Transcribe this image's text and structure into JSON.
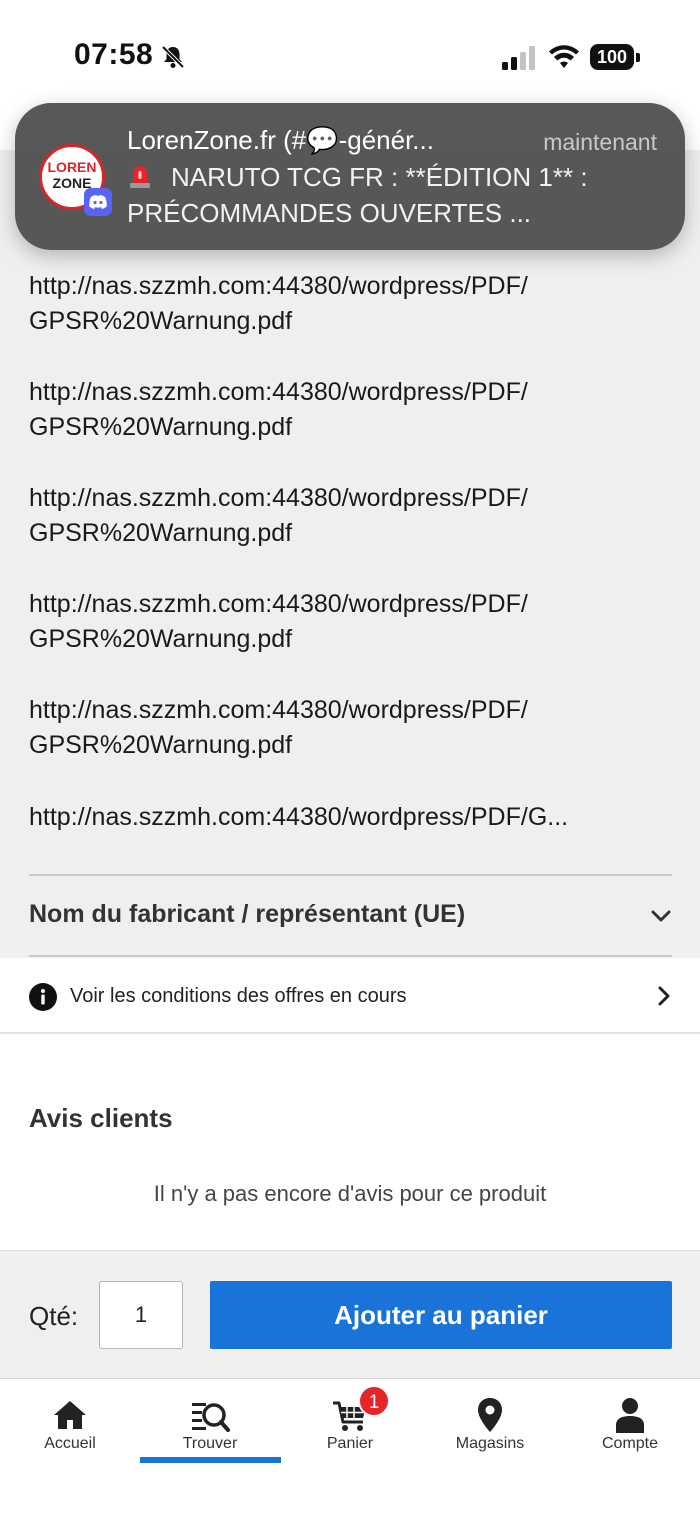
{
  "status_bar": {
    "time": "07:58",
    "battery": "100"
  },
  "notification": {
    "title": "LorenZone.fr (#💬-génér...",
    "time": "maintenant",
    "body": "NARUTO TCG FR : **ÉDITION 1** : PRÉCOMMANDES OUVERTES ...",
    "avatar_line1": "LOREN",
    "avatar_line2": "ZONE"
  },
  "documents": {
    "links": [
      "http://nas.szzmh.com:44380/wordpress/PDF/\nGPSR%20Warnung.pdf",
      "http://nas.szzmh.com:44380/wordpress/PDF/\nGPSR%20Warnung.pdf",
      "http://nas.szzmh.com:44380/wordpress/PDF/\nGPSR%20Warnung.pdf",
      "http://nas.szzmh.com:44380/wordpress/PDF/\nGPSR%20Warnung.pdf",
      "http://nas.szzmh.com:44380/wordpress/PDF/\nGPSR%20Warnung.pdf",
      "http://nas.szzmh.com:44380/wordpress/PDF/G..."
    ]
  },
  "manufacturer": {
    "label": "Nom du fabricant / représentant (UE)"
  },
  "offers": {
    "label": "Voir les conditions des offres en cours"
  },
  "reviews": {
    "title": "Avis clients",
    "empty": "Il n'y a pas encore d'avis pour ce produit"
  },
  "cart_bar": {
    "qty_label": "Qté:",
    "qty_value": "1",
    "add_button": "Ajouter au panier"
  },
  "nav": {
    "items": [
      {
        "label": "Accueil",
        "icon": "home-icon"
      },
      {
        "label": "Trouver",
        "icon": "search-list-icon"
      },
      {
        "label": "Panier",
        "icon": "cart-icon"
      },
      {
        "label": "Magasins",
        "icon": "location-pin-icon"
      },
      {
        "label": "Compte",
        "icon": "user-icon"
      }
    ],
    "active_index": 1,
    "cart_badge": "1"
  },
  "colors": {
    "accent": "#1a73d9",
    "badge": "#e8242b",
    "grey_bg": "#f0efed"
  }
}
